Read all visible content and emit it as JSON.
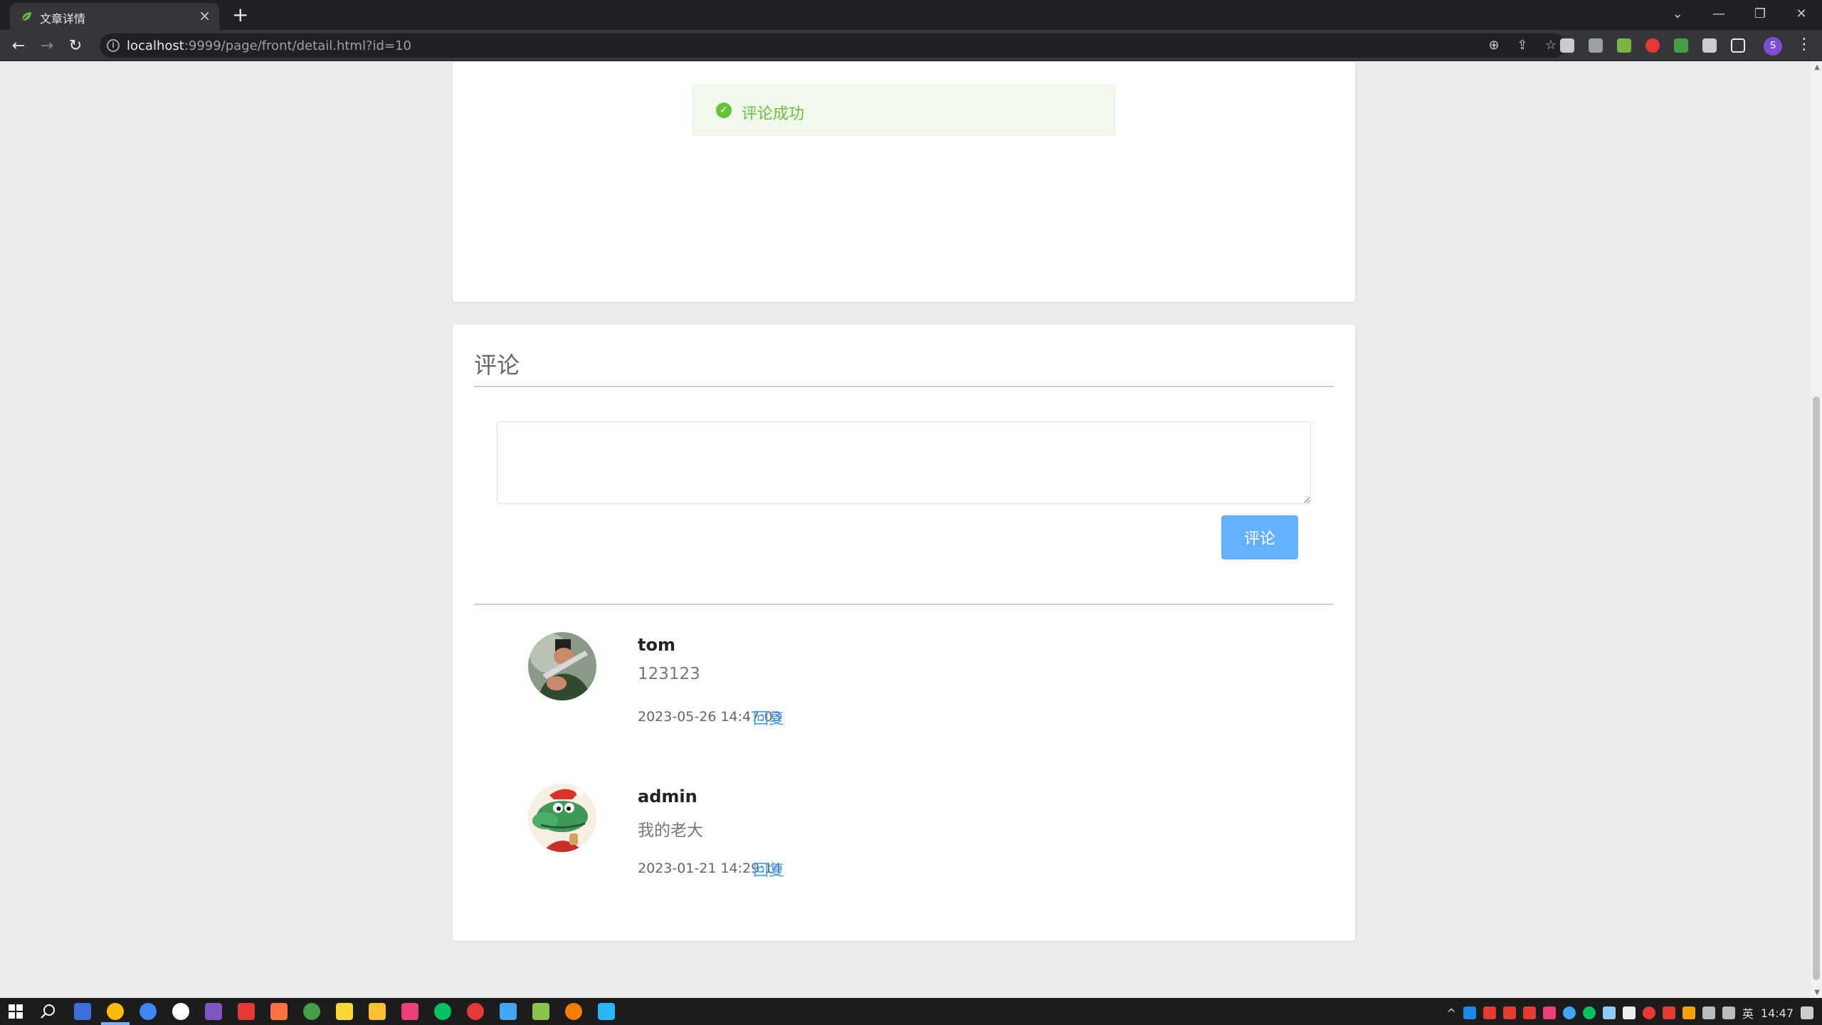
{
  "browser": {
    "tab_title": "文章详情",
    "tab_close": "×",
    "new_tab": "+",
    "url_host": "localhost",
    "url_rest": ":9999/page/front/detail.html?id=10",
    "profile_initial": "S"
  },
  "toast": {
    "message": "评论成功",
    "type": "success",
    "color": "#67c23a"
  },
  "comments_section": {
    "title": "评论",
    "textarea_value": "",
    "submit_label": "评论",
    "items": [
      {
        "name": "tom",
        "text": "123123",
        "time": "2023-05-26 14:47:03",
        "reply_label": "回复"
      },
      {
        "name": "admin",
        "text": "我的老大",
        "time": "2023-01-21 14:29:14",
        "reply_label": "回复"
      }
    ]
  },
  "taskbar": {
    "tray_text": "英",
    "clock_partial": "14:47"
  },
  "colors": {
    "accent": "#409eff",
    "button": "#66b1ff",
    "success": "#67c23a",
    "page_bg": "#ececec"
  }
}
